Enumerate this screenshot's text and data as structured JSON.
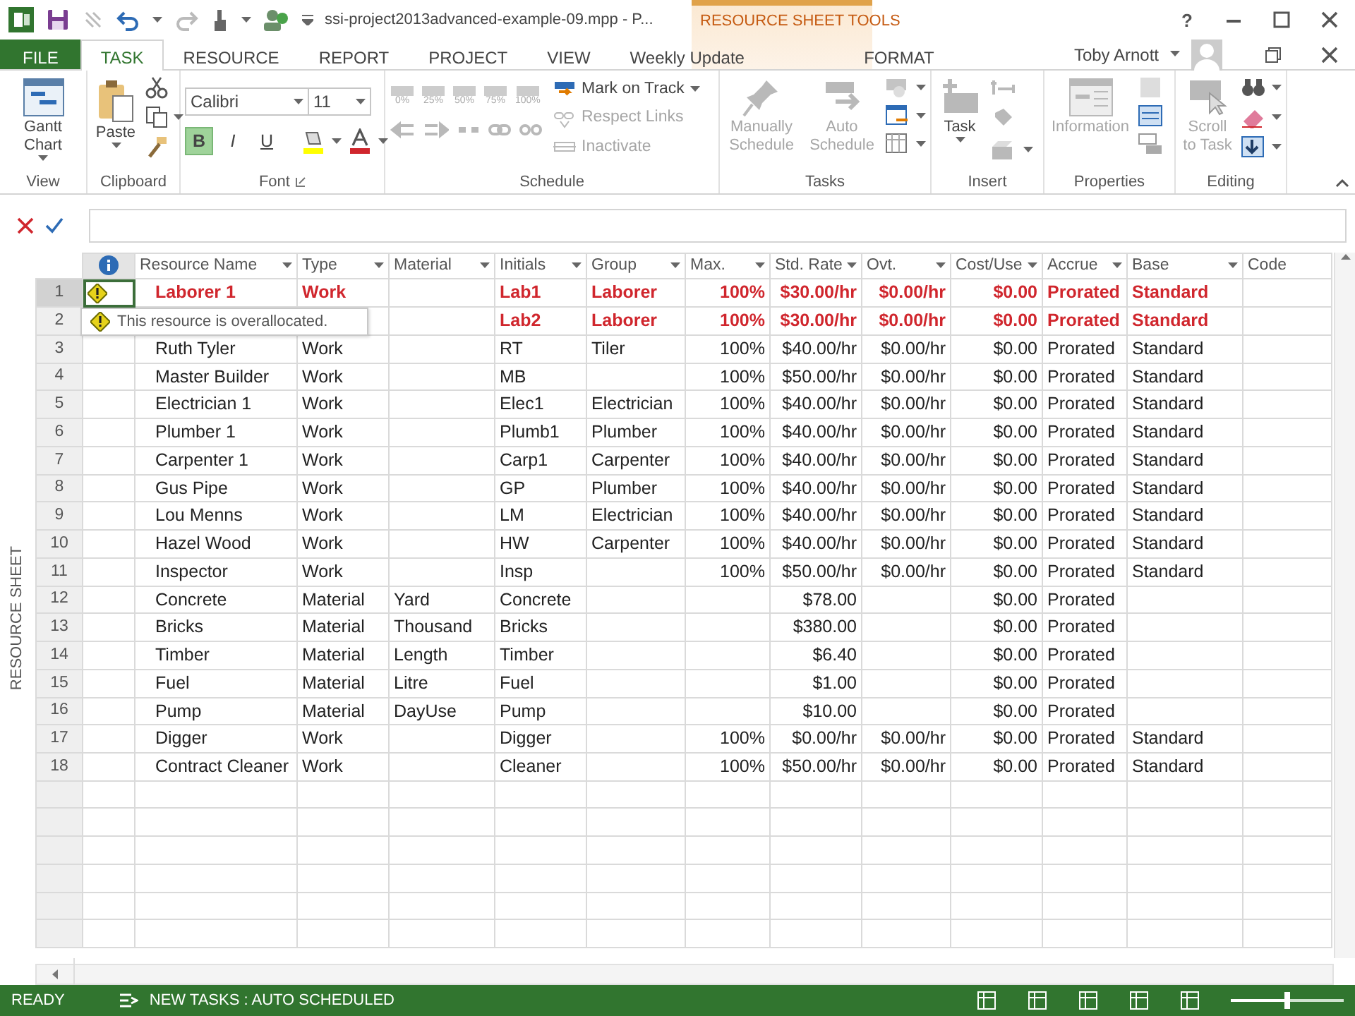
{
  "window": {
    "title": "ssi-project2013advanced-example-09.mpp - P...",
    "contextual_header": "RESOURCE SHEET TOOLS",
    "help": "?"
  },
  "tabs": [
    {
      "label": "FILE",
      "kind": "file",
      "selected": false
    },
    {
      "label": "TASK",
      "kind": "normal",
      "selected": true
    },
    {
      "label": "RESOURCE",
      "kind": "normal",
      "selected": false
    },
    {
      "label": "REPORT",
      "kind": "normal",
      "selected": false
    },
    {
      "label": "PROJECT",
      "kind": "normal",
      "selected": false
    },
    {
      "label": "VIEW",
      "kind": "normal",
      "selected": false
    },
    {
      "label": "Weekly Update",
      "kind": "normal",
      "selected": false
    },
    {
      "label": "FORMAT",
      "kind": "contextual",
      "selected": false
    }
  ],
  "user": {
    "name": "Toby Arnott"
  },
  "ribbon": {
    "groups": [
      {
        "kind": "view",
        "label": "View",
        "buttons": [
          {
            "label": "Gantt Chart",
            "disabled": false
          }
        ]
      },
      {
        "kind": "clipboard",
        "label": "Clipboard",
        "buttons": [
          {
            "label": "Paste",
            "disabled": false
          }
        ]
      },
      {
        "kind": "font",
        "label": "Font",
        "font_name": "Calibri",
        "font_size": "11",
        "toggles": [
          {
            "label": "B",
            "selected": true
          },
          {
            "label": "I",
            "selected": false
          },
          {
            "label": "U",
            "selected": false
          }
        ]
      },
      {
        "kind": "schedule",
        "label": "Schedule",
        "percent_buttons": [
          "0%",
          "25%",
          "50%",
          "75%",
          "100%"
        ],
        "buttons": [
          {
            "label": "Mark on Track",
            "disabled": false
          },
          {
            "label": "Respect Links",
            "disabled": true
          },
          {
            "label": "Inactivate",
            "disabled": true
          }
        ]
      },
      {
        "kind": "tasks",
        "label": "Tasks",
        "buttons": [
          {
            "label": "Manually Schedule",
            "disabled": true
          },
          {
            "label": "Auto Schedule",
            "disabled": true
          }
        ]
      },
      {
        "kind": "insert",
        "label": "Insert",
        "buttons": [
          {
            "label": "Task",
            "disabled": false
          }
        ]
      },
      {
        "kind": "properties",
        "label": "Properties",
        "buttons": [
          {
            "label": "Information",
            "disabled": true
          }
        ]
      },
      {
        "kind": "editing",
        "label": "Editing",
        "buttons": [
          {
            "label": "Scroll to Task",
            "disabled": true
          }
        ]
      }
    ]
  },
  "sheet": {
    "view_label": "RESOURCE SHEET",
    "columns": [
      {
        "label": "Resource Name"
      },
      {
        "label": "Type"
      },
      {
        "label": "Material"
      },
      {
        "label": "Initials"
      },
      {
        "label": "Group"
      },
      {
        "label": "Max."
      },
      {
        "label": "Std. Rate"
      },
      {
        "label": "Ovt."
      },
      {
        "label": "Cost/Use"
      },
      {
        "label": "Accrue"
      },
      {
        "label": "Base"
      },
      {
        "label": "Code"
      }
    ],
    "rows": [
      {
        "num": "1",
        "selected": true,
        "overallocated": true,
        "name": "Laborer 1",
        "type": "Work",
        "initials": "Lab1",
        "group": "Laborer",
        "max": "100%",
        "std_rate": "$30.00/hr",
        "ovt": "$0.00/hr",
        "cost_use": "$0.00",
        "accrue": "Prorated",
        "base": "Standard"
      },
      {
        "num": "2",
        "selected": false,
        "overallocated": true,
        "tooltip": "This resource is overallocated.",
        "initials": "Lab2",
        "group": "Laborer",
        "max": "100%",
        "std_rate": "$30.00/hr",
        "ovt": "$0.00/hr",
        "cost_use": "$0.00",
        "accrue": "Prorated",
        "base": "Standard"
      },
      {
        "num": "3",
        "selected": false,
        "overallocated": false,
        "name": "Ruth Tyler",
        "type": "Work",
        "initials": "RT",
        "group": "Tiler",
        "max": "100%",
        "std_rate": "$40.00/hr",
        "ovt": "$0.00/hr",
        "cost_use": "$0.00",
        "accrue": "Prorated",
        "base": "Standard"
      },
      {
        "num": "4",
        "selected": false,
        "overallocated": false,
        "name": "Master Builder",
        "type": "Work",
        "initials": "MB",
        "max": "100%",
        "std_rate": "$50.00/hr",
        "ovt": "$0.00/hr",
        "cost_use": "$0.00",
        "accrue": "Prorated",
        "base": "Standard"
      },
      {
        "num": "5",
        "selected": false,
        "overallocated": false,
        "name": "Electrician 1",
        "type": "Work",
        "initials": "Elec1",
        "group": "Electrician",
        "max": "100%",
        "std_rate": "$40.00/hr",
        "ovt": "$0.00/hr",
        "cost_use": "$0.00",
        "accrue": "Prorated",
        "base": "Standard"
      },
      {
        "num": "6",
        "selected": false,
        "overallocated": false,
        "name": "Plumber 1",
        "type": "Work",
        "initials": "Plumb1",
        "group": "Plumber",
        "max": "100%",
        "std_rate": "$40.00/hr",
        "ovt": "$0.00/hr",
        "cost_use": "$0.00",
        "accrue": "Prorated",
        "base": "Standard"
      },
      {
        "num": "7",
        "selected": false,
        "overallocated": false,
        "name": "Carpenter 1",
        "type": "Work",
        "initials": "Carp1",
        "group": "Carpenter",
        "max": "100%",
        "std_rate": "$40.00/hr",
        "ovt": "$0.00/hr",
        "cost_use": "$0.00",
        "accrue": "Prorated",
        "base": "Standard"
      },
      {
        "num": "8",
        "selected": false,
        "overallocated": false,
        "name": "Gus Pipe",
        "type": "Work",
        "initials": "GP",
        "group": "Plumber",
        "max": "100%",
        "std_rate": "$40.00/hr",
        "ovt": "$0.00/hr",
        "cost_use": "$0.00",
        "accrue": "Prorated",
        "base": "Standard"
      },
      {
        "num": "9",
        "selected": false,
        "overallocated": false,
        "name": "Lou Menns",
        "type": "Work",
        "initials": "LM",
        "group": "Electrician",
        "max": "100%",
        "std_rate": "$40.00/hr",
        "ovt": "$0.00/hr",
        "cost_use": "$0.00",
        "accrue": "Prorated",
        "base": "Standard"
      },
      {
        "num": "10",
        "selected": false,
        "overallocated": false,
        "name": "Hazel Wood",
        "type": "Work",
        "initials": "HW",
        "group": "Carpenter",
        "max": "100%",
        "std_rate": "$40.00/hr",
        "ovt": "$0.00/hr",
        "cost_use": "$0.00",
        "accrue": "Prorated",
        "base": "Standard"
      },
      {
        "num": "11",
        "selected": false,
        "overallocated": false,
        "name": "Inspector",
        "type": "Work",
        "initials": "Insp",
        "max": "100%",
        "std_rate": "$50.00/hr",
        "ovt": "$0.00/hr",
        "cost_use": "$0.00",
        "accrue": "Prorated",
        "base": "Standard"
      },
      {
        "num": "12",
        "selected": false,
        "overallocated": false,
        "name": "Concrete",
        "type": "Material",
        "material": "Yard",
        "initials": "Concrete",
        "std_rate": "$78.00",
        "cost_use": "$0.00",
        "accrue": "Prorated"
      },
      {
        "num": "13",
        "selected": false,
        "overallocated": false,
        "name": "Bricks",
        "type": "Material",
        "material": "Thousand",
        "initials": "Bricks",
        "std_rate": "$380.00",
        "cost_use": "$0.00",
        "accrue": "Prorated"
      },
      {
        "num": "14",
        "selected": false,
        "overallocated": false,
        "name": "Timber",
        "type": "Material",
        "material": "Length",
        "initials": "Timber",
        "std_rate": "$6.40",
        "cost_use": "$0.00",
        "accrue": "Prorated"
      },
      {
        "num": "15",
        "selected": false,
        "overallocated": false,
        "name": "Fuel",
        "type": "Material",
        "material": "Litre",
        "initials": "Fuel",
        "std_rate": "$1.00",
        "cost_use": "$0.00",
        "accrue": "Prorated"
      },
      {
        "num": "16",
        "selected": false,
        "overallocated": false,
        "name": "Pump",
        "type": "Material",
        "material": "DayUse",
        "initials": "Pump",
        "std_rate": "$10.00",
        "cost_use": "$0.00",
        "accrue": "Prorated"
      },
      {
        "num": "17",
        "selected": false,
        "overallocated": false,
        "name": "Digger",
        "type": "Work",
        "initials": "Digger",
        "max": "100%",
        "std_rate": "$0.00/hr",
        "ovt": "$0.00/hr",
        "cost_use": "$0.00",
        "accrue": "Prorated",
        "base": "Standard"
      },
      {
        "num": "18",
        "selected": false,
        "overallocated": false,
        "name": "Contract Cleaner",
        "type": "Work",
        "initials": "Cleaner",
        "max": "100%",
        "std_rate": "$50.00/hr",
        "ovt": "$0.00/hr",
        "cost_use": "$0.00",
        "accrue": "Prorated",
        "base": "Standard"
      }
    ]
  },
  "status_bar": {
    "mode": "READY",
    "new_tasks": "NEW TASKS : AUTO SCHEDULED",
    "zoom": {
      "level": 0.5
    }
  }
}
